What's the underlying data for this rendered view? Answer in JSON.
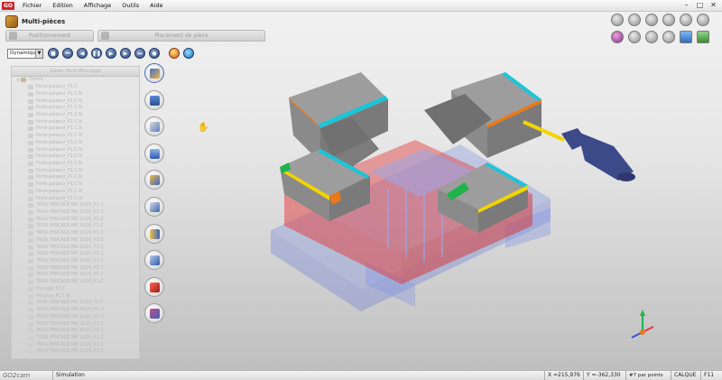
{
  "app": {
    "logo": "GO",
    "menu": [
      "Fichier",
      "Edition",
      "Affichage",
      "Outils",
      "Aide"
    ],
    "brand": "GO2cam"
  },
  "panel": {
    "title": "Multi-pièces",
    "tabs": [
      "Positionnement",
      "Placement de pièce"
    ],
    "mode_select": "Dynamique",
    "tree_header": "Gérer Multi-Montage",
    "tree_items": [
      "Ordres",
      "Porte-palpeur_P1.C",
      "Porte-palpeur_P1.C.N",
      "Porte-palpeur_P1.C.N",
      "Porte-palpeur_P1.C.N",
      "Porte-palpeur_P1.C.N",
      "Porte-palpeur_P1.C.N",
      "Porte-palpeur_P1.C.N",
      "Porte-palpeur_P1.C.N",
      "Porte-palpeur_P1.C.N",
      "Porte-palpeur_P1.C.N",
      "Porte-palpeur_P1.C.N",
      "Porte-palpeur_P1.C.N",
      "Porte-palpeur_P1.C.N",
      "Porte-palpeur_P1.C.N",
      "Porte-palpeur_P1.C.N",
      "Porte-palpeur_P1.C.N",
      "Porte-palpeur_P1.C.N",
      "TROU PERCAGE M8 10/20_P1.C",
      "TROU PERCAGE M8 10/20_P1.C",
      "TROU PERCAGE M8 10/20_P1.C",
      "TROU PERCAGE M8 10/20_P1.C",
      "TROU PERCAGE M8 10/20_P1.C",
      "TROU PERCAGE M8 10/20_P1.C",
      "TROU PERCAGE M8 10/20_P1.C",
      "TROU PERCAGE M8 10/20_P1.C",
      "TROU PERCAGE M8 10/20_P1.C",
      "TROU PERCAGE M8 10/20_P1.C",
      "TROU PERCAGE M8 10/20_P1.C",
      "TROU PERCAGE M8 10/20_P1.C",
      "Perçage_P1.C",
      "Perçage_P1.C.N",
      "TROU PERCAGE M8 10/20_P1.C",
      "TROU PERCAGE M8 10/20_P1.C",
      "TROU PERCAGE M8 10/20_P1.C",
      "TROU PERCAGE M8 10/20_P1.C",
      "TROU PERCAGE M8 10/20_P1.C",
      "TROU PERCAGE M8 10/20_P1.C",
      "TROU PERCAGE M8 10/20_P1.C",
      "TROU PERCAGE M8 10/20_P1.C"
    ]
  },
  "colors": {
    "block": "#8f8f8f",
    "red": "#e33a3a",
    "blue": "#7b8fe0",
    "cyan": "#19c6d8",
    "yellow": "#f2d400",
    "green": "#1fb34a",
    "orange": "#e87a1c",
    "tool": "#3d4a8a"
  },
  "status": {
    "mode": "Simulation",
    "x": "X =215,976",
    "y": "Y =-362,330",
    "points": "#7 par points No 7",
    "layer": "CALQUE : 1",
    "page": "F11 :1"
  }
}
